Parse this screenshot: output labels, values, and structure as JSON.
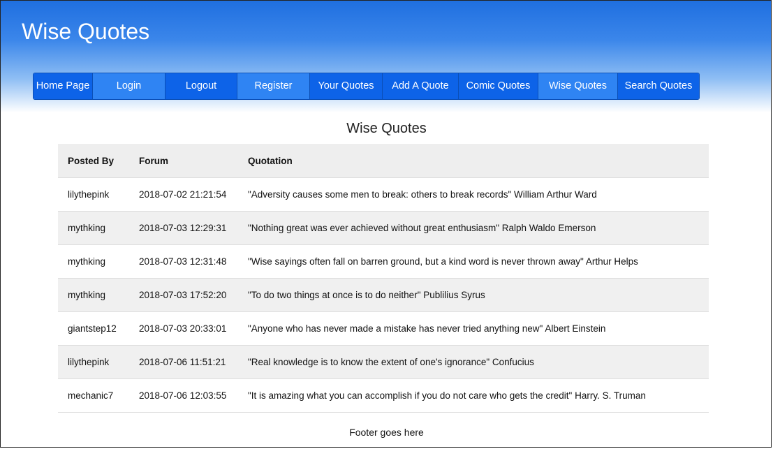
{
  "site": {
    "title": "Wise Quotes"
  },
  "nav": {
    "items": [
      {
        "label": "Home Page"
      },
      {
        "label": "Login"
      },
      {
        "label": "Logout"
      },
      {
        "label": "Register"
      },
      {
        "label": "Your Quotes"
      },
      {
        "label": "Add A Quote"
      },
      {
        "label": "Comic Quotes"
      },
      {
        "label": "Wise Quotes"
      },
      {
        "label": "Search Quotes"
      }
    ]
  },
  "main": {
    "heading": "Wise Quotes",
    "table": {
      "headers": [
        "Posted By",
        "Forum",
        "Quotation"
      ],
      "rows": [
        {
          "user": "lilythepink",
          "forum": "2018-07-02 21:21:54",
          "quote": "\"Adversity causes some men to break: others to break records\" William Arthur Ward"
        },
        {
          "user": "mythking",
          "forum": "2018-07-03 12:29:31",
          "quote": "\"Nothing great was ever achieved without great enthusiasm\" Ralph Waldo Emerson"
        },
        {
          "user": "mythking",
          "forum": "2018-07-03 12:31:48",
          "quote": "\"Wise sayings often fall on barren ground, but a kind word is never thrown away\" Arthur Helps"
        },
        {
          "user": "mythking",
          "forum": "2018-07-03 17:52:20",
          "quote": "\"To do two things at once is to do neither\" Publilius Syrus"
        },
        {
          "user": "giantstep12",
          "forum": "2018-07-03 20:33:01",
          "quote": "\"Anyone who has never made a mistake has never tried anything new\" Albert Einstein"
        },
        {
          "user": "lilythepink",
          "forum": "2018-07-06 11:51:21",
          "quote": "\"Real knowledge is to know the extent of one's ignorance\" Confucius"
        },
        {
          "user": "mechanic7",
          "forum": "2018-07-06 12:03:55",
          "quote": "\"It is amazing what you can accomplish if you do not care who gets the credit\" Harry. S. Truman"
        }
      ]
    }
  },
  "footer": {
    "text": "Footer goes here"
  },
  "colors": {
    "nav_dark": "#0d63e8",
    "nav_light": "#2f84f3",
    "header_top": "#1f6fe0",
    "row_alt": "#f0f0f0"
  }
}
